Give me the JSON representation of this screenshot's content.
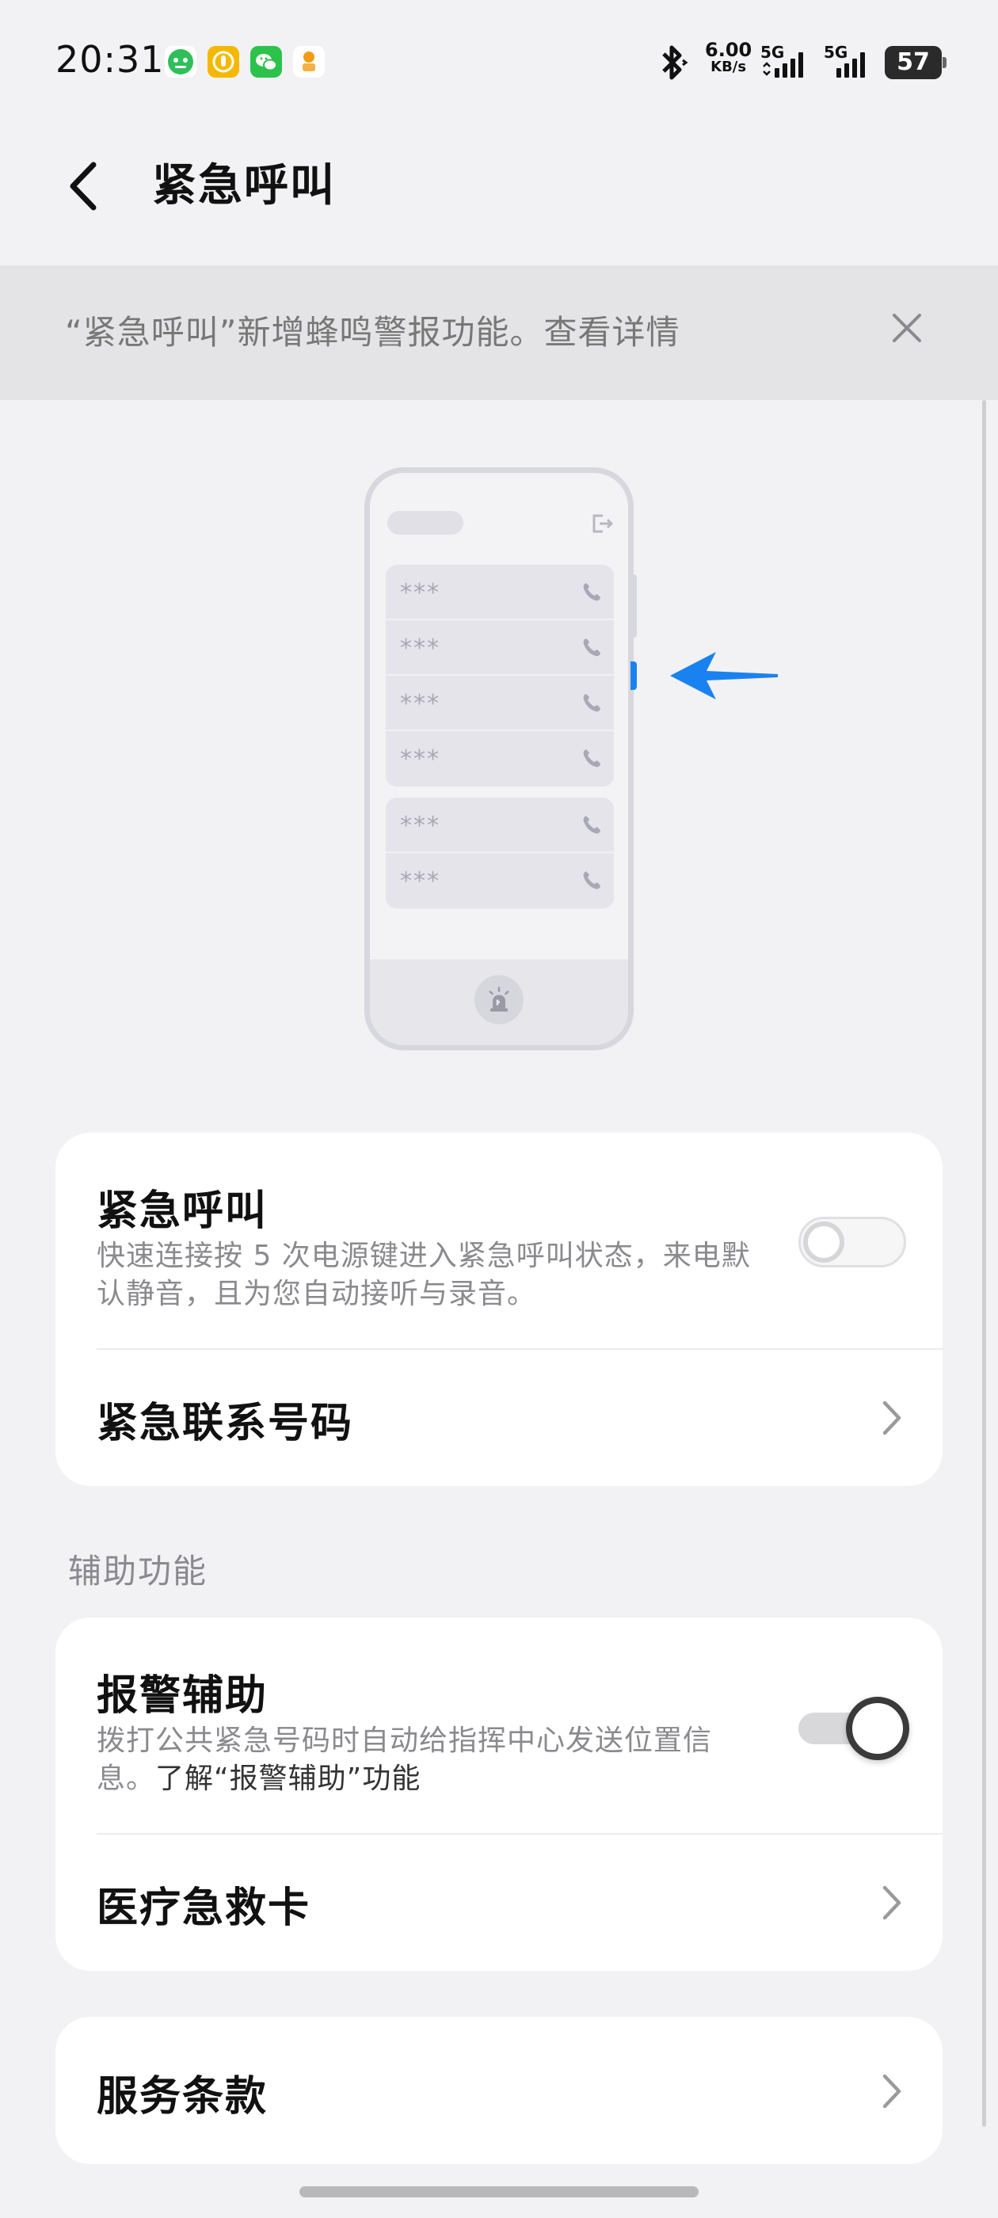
{
  "status_bar": {
    "time": "20:31",
    "net_speed_value": "6.00",
    "net_speed_unit": "KB/s",
    "sim1_label": "5G",
    "sim2_label": "5G",
    "battery": "57"
  },
  "header": {
    "title": "紧急呼叫"
  },
  "banner": {
    "text": "“紧急呼叫”新增蜂鸣警报功能。查看详情"
  },
  "illustration": {
    "masked_contact": "***",
    "accent_color": "#1a82f0"
  },
  "card_emergency": {
    "emergency_call": {
      "title": "紧急呼叫",
      "desc": "快速连接按 5 次电源键进入紧急呼叫状态，来电默认静音，且为您自动接听与录音。",
      "enabled": false
    },
    "emergency_contacts": {
      "title": "紧急联系号码"
    }
  },
  "section_assist": {
    "label": "辅助功能"
  },
  "card_assist": {
    "police_assist": {
      "title": "报警辅助",
      "desc_prefix": "拨打公共紧急号码时自动给指挥中心发送位置信息。",
      "desc_link": "了解“报警辅助”功能",
      "enabled": true
    },
    "medical_card": {
      "title": "医疗急救卡"
    }
  },
  "card_terms": {
    "terms": {
      "title": "服务条款"
    }
  }
}
